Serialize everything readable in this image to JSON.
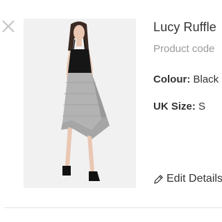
{
  "item": {
    "name": "Lucy Ruffle",
    "code_label": "Product code",
    "colour_label": "Colour:",
    "colour_value": "Black",
    "size_label": "UK Size:",
    "size_value": "S",
    "edit_label": "Edit Details",
    "close_icon": "close-icon",
    "edit_icon": "pencil-icon",
    "image": "product-photo"
  },
  "colors": {
    "text": "#333333",
    "muted": "#9a9a9a",
    "close": "#c4c4c4",
    "divider": "#e3e3e3",
    "image_bg": "#f1f1f1"
  }
}
